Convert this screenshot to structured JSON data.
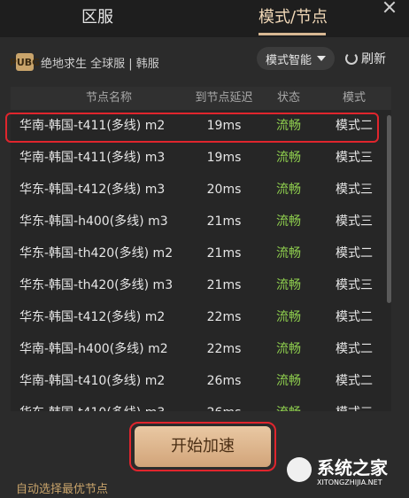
{
  "tabs": {
    "region": "区服",
    "mode_node": "模式/节点"
  },
  "game": {
    "logo_text": "PUBG",
    "name": "绝地求生 全球服 | 韩服"
  },
  "controls": {
    "mode_select": "模式智能",
    "refresh": "刷新"
  },
  "table": {
    "headers": [
      "节点名称",
      "到节点延迟",
      "状态",
      "模式"
    ],
    "rows": [
      {
        "name": "华南-韩国-t411(多线) m2",
        "latency": "19ms",
        "status": "流畅",
        "mode": "模式二"
      },
      {
        "name": "华南-韩国-t411(多线) m3",
        "latency": "19ms",
        "status": "流畅",
        "mode": "模式三"
      },
      {
        "name": "华东-韩国-t412(多线) m3",
        "latency": "20ms",
        "status": "流畅",
        "mode": "模式三"
      },
      {
        "name": "华东-韩国-h400(多线) m3",
        "latency": "21ms",
        "status": "流畅",
        "mode": "模式三"
      },
      {
        "name": "华东-韩国-th420(多线) m2",
        "latency": "21ms",
        "status": "流畅",
        "mode": "模式二"
      },
      {
        "name": "华东-韩国-th420(多线) m3",
        "latency": "21ms",
        "status": "流畅",
        "mode": "模式三"
      },
      {
        "name": "华东-韩国-t412(多线) m2",
        "latency": "22ms",
        "status": "流畅",
        "mode": "模式二"
      },
      {
        "name": "华南-韩国-h400(多线) m2",
        "latency": "22ms",
        "status": "流畅",
        "mode": "模式二"
      },
      {
        "name": "华南-韩国-t410(多线) m2",
        "latency": "26ms",
        "status": "流畅",
        "mode": "模式二"
      },
      {
        "name": "华东-韩国-t410(多线) m3",
        "latency": "26ms",
        "status": "流畅",
        "mode": "模式三"
      }
    ]
  },
  "footer": {
    "start_button": "开始加速",
    "auto_hint": "自动选择最优节点"
  },
  "watermark": {
    "title": "系统之家",
    "url": "XITONGZHIJIA.NET"
  },
  "colors": {
    "accent": "#d8b893",
    "status_good": "#8fcf4e",
    "highlight": "#e0252d"
  }
}
